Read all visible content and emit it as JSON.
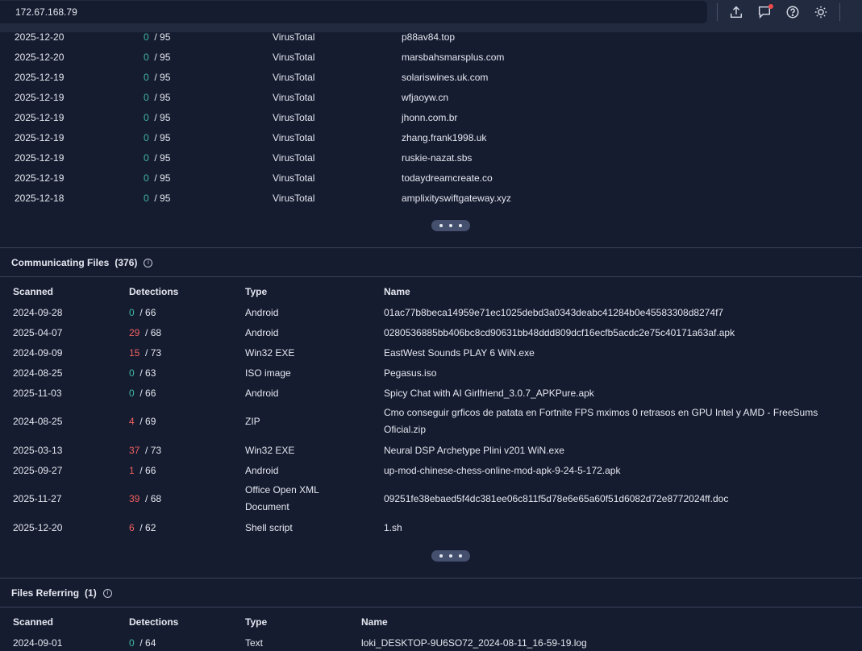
{
  "topbar": {
    "search_value": "172.67.168.79",
    "icons": [
      "upload-icon",
      "chat-icon",
      "help-icon",
      "theme-icon"
    ]
  },
  "colors": {
    "clean": "#3fb8a3",
    "malicious": "#f0605e",
    "background": "#161c30",
    "topbar": "#222a40"
  },
  "resolutions": {
    "rows": [
      {
        "date": "2025-12-20",
        "det": "0",
        "total": "/ 95",
        "resolver": "VirusTotal",
        "domain": "p88av84.top"
      },
      {
        "date": "2025-12-20",
        "det": "0",
        "total": "/ 95",
        "resolver": "VirusTotal",
        "domain": "marsbahsmarsplus.com"
      },
      {
        "date": "2025-12-19",
        "det": "0",
        "total": "/ 95",
        "resolver": "VirusTotal",
        "domain": "solariswines.uk.com"
      },
      {
        "date": "2025-12-19",
        "det": "0",
        "total": "/ 95",
        "resolver": "VirusTotal",
        "domain": "wfjaoyw.cn"
      },
      {
        "date": "2025-12-19",
        "det": "0",
        "total": "/ 95",
        "resolver": "VirusTotal",
        "domain": "jhonn.com.br"
      },
      {
        "date": "2025-12-19",
        "det": "0",
        "total": "/ 95",
        "resolver": "VirusTotal",
        "domain": "zhang.frank1998.uk"
      },
      {
        "date": "2025-12-19",
        "det": "0",
        "total": "/ 95",
        "resolver": "VirusTotal",
        "domain": "ruskie-nazat.sbs"
      },
      {
        "date": "2025-12-19",
        "det": "0",
        "total": "/ 95",
        "resolver": "VirusTotal",
        "domain": "todaydreamcreate.co"
      },
      {
        "date": "2025-12-18",
        "det": "0",
        "total": "/ 95",
        "resolver": "VirusTotal",
        "domain": "amplixityswiftgateway.xyz"
      }
    ]
  },
  "communicating": {
    "title": "Communicating Files",
    "count": "(376)",
    "headers": {
      "scanned": "Scanned",
      "detections": "Detections",
      "type": "Type",
      "name": "Name"
    },
    "rows": [
      {
        "date": "2024-09-28",
        "det": "0",
        "total": "/ 66",
        "type": "Android",
        "name": "01ac77b8beca14959e71ec1025debd3a0343deabc41284b0e45583308d8274f7"
      },
      {
        "date": "2025-04-07",
        "det": "29",
        "total": "/ 68",
        "type": "Android",
        "name": "0280536885bb406bc8cd90631bb48ddd809dcf16ecfb5acdc2e75c40171a63af.apk"
      },
      {
        "date": "2024-09-09",
        "det": "15",
        "total": "/ 73",
        "type": "Win32 EXE",
        "name": "EastWest Sounds PLAY 6 WiN.exe"
      },
      {
        "date": "2024-08-25",
        "det": "0",
        "total": "/ 63",
        "type": "ISO image",
        "name": "Pegasus.iso"
      },
      {
        "date": "2025-11-03",
        "det": "0",
        "total": "/ 66",
        "type": "Android",
        "name": "Spicy Chat with AI Girlfriend_3.0.7_APKPure.apk"
      },
      {
        "date": "2024-08-25",
        "det": "4",
        "total": "/ 69",
        "type": "ZIP",
        "name": "Cmo conseguir grficos de patata en Fortnite FPS mximos 0 retrasos en GPU Intel y AMD - FreeSums Oficial.zip"
      },
      {
        "date": "2025-03-13",
        "det": "37",
        "total": "/ 73",
        "type": "Win32 EXE",
        "name": "Neural DSP Archetype Plini v201 WiN.exe"
      },
      {
        "date": "2025-09-27",
        "det": "1",
        "total": "/ 66",
        "type": "Android",
        "name": "up-mod-chinese-chess-online-mod-apk-9-24-5-172.apk"
      },
      {
        "date": "2025-11-27",
        "det": "39",
        "total": "/ 68",
        "type": "Office Open XML Document",
        "name": "09251fe38ebaed5f4dc381ee06c811f5d78e6e65a60f51d6082d72e8772024ff.doc"
      },
      {
        "date": "2025-12-20",
        "det": "6",
        "total": "/ 62",
        "type": "Shell script",
        "name": "1.sh"
      }
    ]
  },
  "referring": {
    "title": "Files Referring",
    "count": "(1)",
    "headers": {
      "scanned": "Scanned",
      "detections": "Detections",
      "type": "Type",
      "name": "Name"
    },
    "rows": [
      {
        "date": "2024-09-01",
        "det": "0",
        "total": "/ 64",
        "type": "Text",
        "name": "loki_DESKTOP-9U6SO72_2024-08-11_16-59-19.log"
      }
    ]
  }
}
